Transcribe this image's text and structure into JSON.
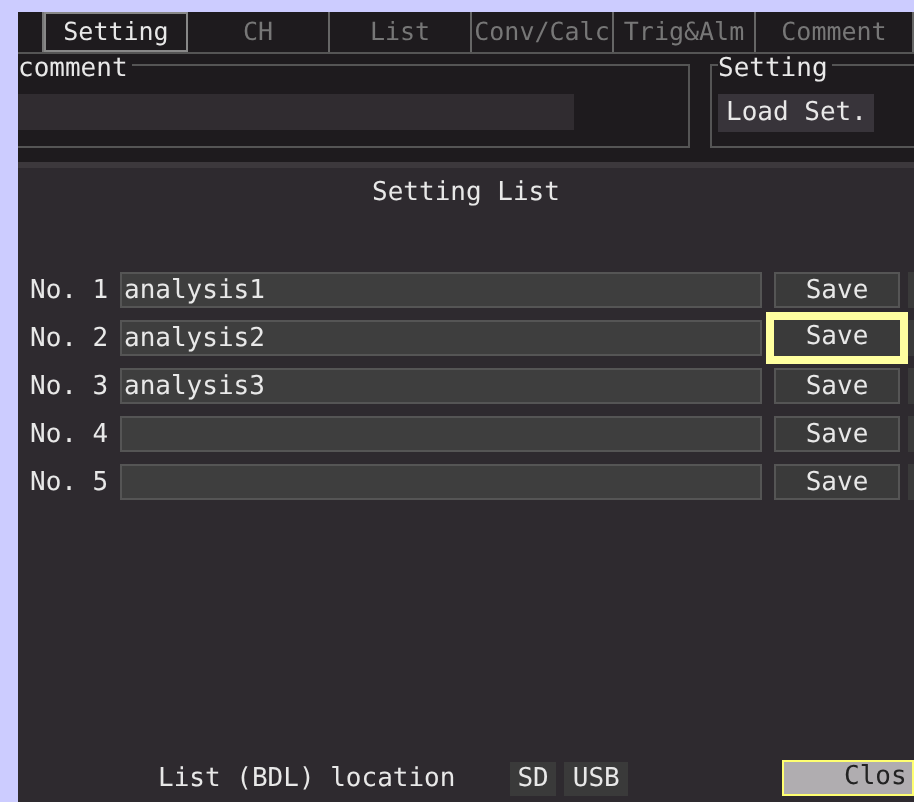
{
  "tabs": [
    {
      "label": "Setting",
      "selected": true
    },
    {
      "label": "CH",
      "selected": false
    },
    {
      "label": "List",
      "selected": false
    },
    {
      "label": "Conv/Calc",
      "selected": false
    },
    {
      "label": "Trig&Alm",
      "selected": false
    },
    {
      "label": "Comment",
      "selected": false
    }
  ],
  "comment_group": {
    "title": "comment"
  },
  "setting_group": {
    "title": "Setting",
    "button": "Load Set."
  },
  "dialog": {
    "title": "Setting List",
    "rows": [
      {
        "number": "No. 1",
        "name": "analysis1",
        "button": "Save",
        "focused": false
      },
      {
        "number": "No. 2",
        "name": "analysis2",
        "button": "Save",
        "focused": true
      },
      {
        "number": "No. 3",
        "name": "analysis3",
        "button": "Save",
        "focused": false
      },
      {
        "number": "No. 4",
        "name": "",
        "button": "Save",
        "focused": false
      },
      {
        "number": "No. 5",
        "name": "",
        "button": "Save",
        "focused": false
      }
    ],
    "location_label": "List (BDL) location",
    "locations": [
      "SD",
      "USB"
    ],
    "close_button": "Clos"
  }
}
